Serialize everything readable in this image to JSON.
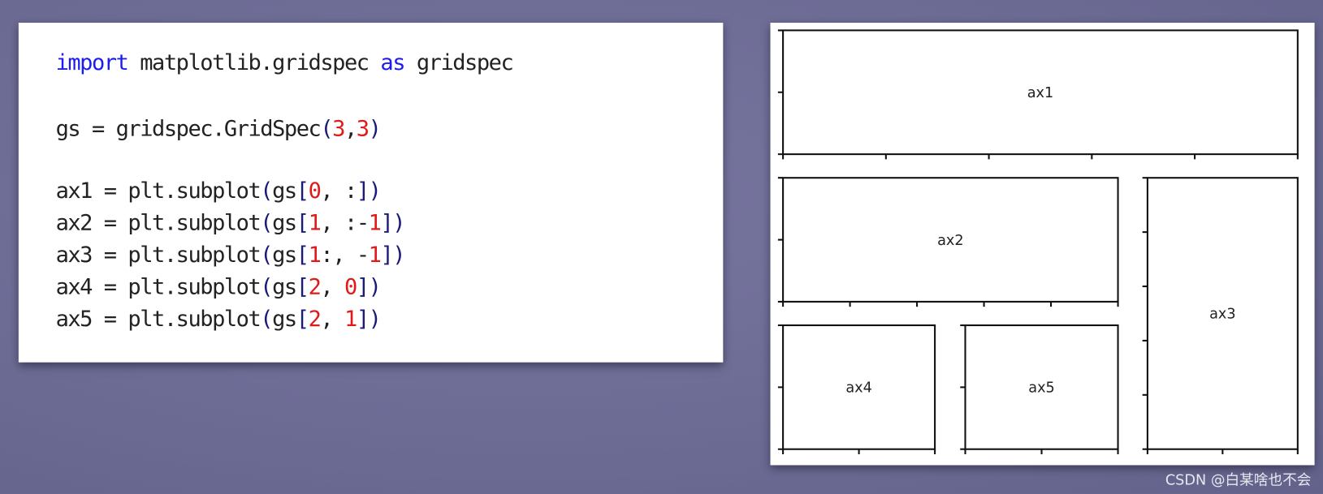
{
  "code": {
    "lines": [
      [
        {
          "t": "import",
          "c": "kw"
        },
        {
          "t": " matplotlib.gridspec "
        },
        {
          "t": "as",
          "c": "kw"
        },
        {
          "t": " gridspec"
        }
      ],
      [
        {
          "t": "gs = gridspec.GridSpec"
        },
        {
          "t": "(",
          "c": "br"
        },
        {
          "t": "3",
          "c": "num"
        },
        {
          "t": ","
        },
        {
          "t": "3",
          "c": "num"
        },
        {
          "t": ")",
          "c": "br"
        }
      ],
      [
        {
          "t": "ax1 = plt.subplot"
        },
        {
          "t": "(",
          "c": "br"
        },
        {
          "t": "gs"
        },
        {
          "t": "[",
          "c": "br"
        },
        {
          "t": "0",
          "c": "num"
        },
        {
          "t": ", :"
        },
        {
          "t": "])",
          "c": "br"
        }
      ],
      [
        {
          "t": "ax2 = plt.subplot"
        },
        {
          "t": "(",
          "c": "br"
        },
        {
          "t": "gs"
        },
        {
          "t": "[",
          "c": "br"
        },
        {
          "t": "1",
          "c": "num"
        },
        {
          "t": ", :-"
        },
        {
          "t": "1",
          "c": "num"
        },
        {
          "t": "])",
          "c": "br"
        }
      ],
      [
        {
          "t": "ax3 = plt.subplot"
        },
        {
          "t": "(",
          "c": "br"
        },
        {
          "t": "gs"
        },
        {
          "t": "[",
          "c": "br"
        },
        {
          "t": "1",
          "c": "num"
        },
        {
          "t": ":, -"
        },
        {
          "t": "1",
          "c": "num"
        },
        {
          "t": "])",
          "c": "br"
        }
      ],
      [
        {
          "t": "ax4 = plt.subplot"
        },
        {
          "t": "(",
          "c": "br"
        },
        {
          "t": "gs"
        },
        {
          "t": "[",
          "c": "br"
        },
        {
          "t": "2",
          "c": "num"
        },
        {
          "t": ", "
        },
        {
          "t": "0",
          "c": "num"
        },
        {
          "t": "])",
          "c": "br"
        }
      ],
      [
        {
          "t": "ax5 = plt.subplot"
        },
        {
          "t": "(",
          "c": "br"
        },
        {
          "t": "gs"
        },
        {
          "t": "[",
          "c": "br"
        },
        {
          "t": "2",
          "c": "num"
        },
        {
          "t": ", "
        },
        {
          "t": "1",
          "c": "num"
        },
        {
          "t": "])",
          "c": "br"
        }
      ]
    ]
  },
  "figure": {
    "grid": {
      "rows": 3,
      "cols": 3
    },
    "axes": [
      {
        "label": "ax1",
        "rows": [
          0,
          1
        ],
        "cols": [
          0,
          3
        ],
        "xticks": 6,
        "yticks": 3
      },
      {
        "label": "ax2",
        "rows": [
          1,
          2
        ],
        "cols": [
          0,
          2
        ],
        "xticks": 6,
        "yticks": 3
      },
      {
        "label": "ax3",
        "rows": [
          1,
          3
        ],
        "cols": [
          2,
          3
        ],
        "xticks": 3,
        "yticks": 6
      },
      {
        "label": "ax4",
        "rows": [
          2,
          3
        ],
        "cols": [
          0,
          1
        ],
        "xticks": 3,
        "yticks": 3
      },
      {
        "label": "ax5",
        "rows": [
          2,
          3
        ],
        "cols": [
          1,
          2
        ],
        "xticks": 3,
        "yticks": 3
      }
    ]
  },
  "colors": {
    "keyword": "#1c1cf0",
    "number": "#e01a1a",
    "bracket": "#1a1a7a",
    "background": "#6d6c95"
  },
  "watermark": "CSDN @白某啥也不会"
}
